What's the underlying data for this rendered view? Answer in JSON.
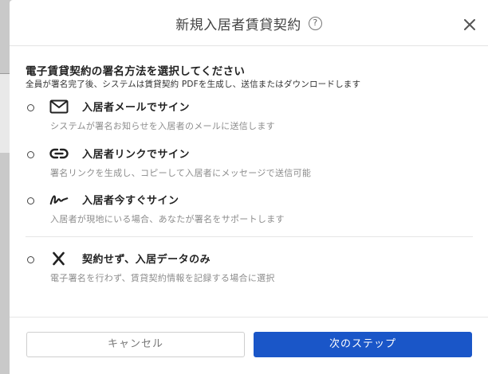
{
  "dialog": {
    "title": "新規入居者賃貸契約",
    "help_icon": "help-circle-icon",
    "close_icon": "close-icon"
  },
  "section": {
    "title": "電子賃貸契約の署名方法を選択してください",
    "description": "全員が署名完了後、システムは賃貸契約 PDFを生成し、送信またはダウンロードします"
  },
  "options": [
    {
      "icon": "mail-icon",
      "label": "入居者メールでサイン",
      "description": "システムが署名お知らせを入居者のメールに送信します",
      "selected": false
    },
    {
      "icon": "link-icon",
      "label": "入居者リンクでサイン",
      "description": "署名リンクを生成し、コピーして入居者にメッセージで送信可能",
      "selected": false
    },
    {
      "icon": "signature-icon",
      "label": "入居者今すぐサイン",
      "description": "入居者が現地にいる場合、あなたが署名をサポートします",
      "selected": false
    },
    {
      "icon": "x-icon",
      "label": "契約せず、入居データのみ",
      "description": "電子署名を行わず、賃貸契約情報を記録する場合に選択",
      "selected": false
    }
  ],
  "footer": {
    "cancel_label": "キャンセル",
    "next_label": "次のステップ"
  },
  "colors": {
    "primary": "#1a56c8",
    "muted_text": "#8c8c8c",
    "backdrop": "#c9c9c9"
  }
}
